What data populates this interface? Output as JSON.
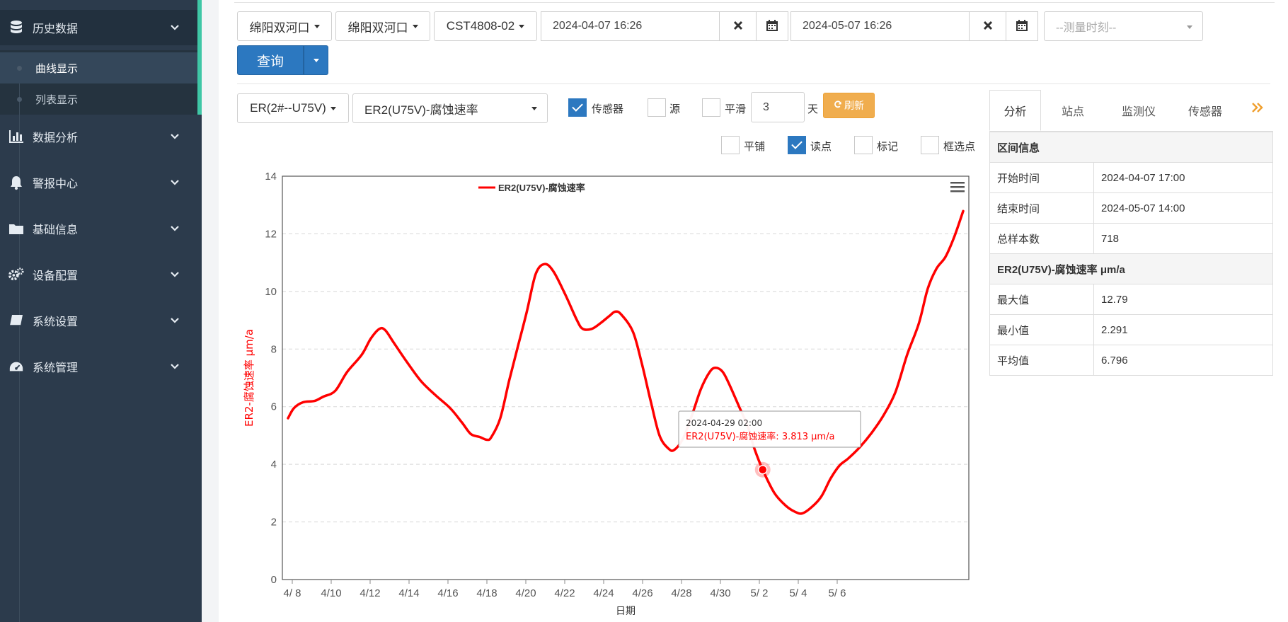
{
  "sidebar": {
    "items": [
      {
        "label": "历史数据",
        "icon": "database-icon"
      },
      {
        "label": "数据分析",
        "icon": "bar-chart-icon"
      },
      {
        "label": "警报中心",
        "icon": "bell-icon"
      },
      {
        "label": "基础信息",
        "icon": "folder-icon"
      },
      {
        "label": "设备配置",
        "icon": "gears-icon"
      },
      {
        "label": "系统设置",
        "icon": "book-icon"
      },
      {
        "label": "系统管理",
        "icon": "dashboard-icon"
      }
    ],
    "subitems": [
      {
        "label": "曲线显示",
        "active": true
      },
      {
        "label": "列表显示",
        "active": false
      }
    ]
  },
  "toolbar": {
    "region1": "绵阳双河口",
    "region2": "绵阳双河口",
    "device": "CST4808-02",
    "start_time": "2024-04-07 16:26",
    "end_time": "2024-05-07 16:26",
    "measure_placeholder": "--测量时刻--",
    "query_label": "查询"
  },
  "options": {
    "probe_select": "ER(2#--U75V)",
    "metric_select": "ER2(U75V)-腐蚀速率",
    "sensor_label": "传感器",
    "source_label": "源",
    "smooth_label": "平滑",
    "smooth_value": "3",
    "days_label": "天",
    "refresh_label": "刷新",
    "tile_label": "平铺",
    "readpoint_label": "读点",
    "mark_label": "标记",
    "boxselect_label": "框选点",
    "checks": {
      "sensor": true,
      "source": false,
      "smooth": false,
      "tile": false,
      "readpoint": true,
      "mark": false,
      "boxselect": false
    }
  },
  "chart_data": {
    "type": "line",
    "legend": "ER2(U75V)-腐蚀速率",
    "legend_position": "top-left",
    "series": [
      {
        "name": "ER2(U75V)-腐蚀速率",
        "color": "#ff0000",
        "points": [
          [
            0.0,
            5.6
          ],
          [
            0.2,
            5.95
          ],
          [
            0.5,
            6.15
          ],
          [
            0.9,
            6.2
          ],
          [
            1.2,
            6.35
          ],
          [
            1.6,
            6.55
          ],
          [
            2.0,
            7.2
          ],
          [
            2.5,
            7.8
          ],
          [
            2.8,
            8.35
          ],
          [
            3.1,
            8.7
          ],
          [
            3.3,
            8.65
          ],
          [
            3.6,
            8.2
          ],
          [
            4.0,
            7.6
          ],
          [
            4.5,
            6.9
          ],
          [
            5.0,
            6.4
          ],
          [
            5.5,
            5.95
          ],
          [
            5.9,
            5.45
          ],
          [
            6.2,
            5.05
          ],
          [
            6.5,
            4.95
          ],
          [
            6.75,
            4.85
          ],
          [
            6.9,
            4.95
          ],
          [
            7.2,
            5.6
          ],
          [
            7.5,
            6.9
          ],
          [
            7.8,
            8.1
          ],
          [
            8.1,
            9.3
          ],
          [
            8.4,
            10.6
          ],
          [
            8.7,
            10.95
          ],
          [
            9.0,
            10.7
          ],
          [
            9.4,
            9.9
          ],
          [
            9.8,
            9.0
          ],
          [
            10.0,
            8.7
          ],
          [
            10.3,
            8.7
          ],
          [
            10.6,
            8.9
          ],
          [
            10.9,
            9.15
          ],
          [
            11.1,
            9.3
          ],
          [
            11.3,
            9.2
          ],
          [
            11.7,
            8.6
          ],
          [
            12.0,
            7.5
          ],
          [
            12.3,
            6.2
          ],
          [
            12.6,
            5.0
          ],
          [
            12.9,
            4.55
          ],
          [
            13.1,
            4.5
          ],
          [
            13.4,
            4.9
          ],
          [
            13.7,
            5.7
          ],
          [
            14.0,
            6.6
          ],
          [
            14.3,
            7.2
          ],
          [
            14.5,
            7.35
          ],
          [
            14.75,
            7.2
          ],
          [
            15.0,
            6.7
          ],
          [
            15.3,
            6.0
          ],
          [
            15.6,
            5.3
          ],
          [
            15.8,
            4.6
          ],
          [
            16.1,
            3.813
          ],
          [
            16.5,
            3.0
          ],
          [
            16.9,
            2.55
          ],
          [
            17.2,
            2.35
          ],
          [
            17.45,
            2.3
          ],
          [
            17.8,
            2.55
          ],
          [
            18.1,
            2.9
          ],
          [
            18.4,
            3.5
          ],
          [
            18.7,
            3.95
          ],
          [
            19.0,
            4.2
          ],
          [
            19.4,
            4.6
          ],
          [
            19.8,
            5.1
          ],
          [
            20.2,
            5.7
          ],
          [
            20.6,
            6.5
          ],
          [
            21.0,
            7.8
          ],
          [
            21.4,
            8.9
          ],
          [
            21.7,
            10.1
          ],
          [
            22.0,
            10.8
          ],
          [
            22.3,
            11.2
          ],
          [
            22.6,
            11.9
          ],
          [
            22.9,
            12.79
          ]
        ]
      }
    ],
    "x_ticks": [
      "4/ 8",
      "4/10",
      "4/12",
      "4/14",
      "4/16",
      "4/18",
      "4/20",
      "4/22",
      "4/24",
      "4/26",
      "4/28",
      "4/30",
      "5/ 2",
      "5/ 4",
      "5/ 6"
    ],
    "x_range": [
      "2024-04-07 17:00",
      "2024-05-07 14:00"
    ],
    "xlabel": "日期",
    "ylabel": "ER2-腐蚀速率 μm/a",
    "ylim": [
      0,
      14
    ],
    "y_ticks": [
      0,
      2,
      4,
      6,
      8,
      10,
      12,
      14
    ],
    "grid": true,
    "tooltip": {
      "time": "2024-04-29 02:00",
      "text": "ER2(U75V)-腐蚀速率: 3.813 μm/a",
      "x": 16.1,
      "y": 3.813
    }
  },
  "panel": {
    "tabs": [
      "分析",
      "站点",
      "监测仪",
      "传感器"
    ],
    "active_tab": "分析",
    "section1_title": "区间信息",
    "rows1": [
      {
        "k": "开始时间",
        "v": "2024-04-07 17:00"
      },
      {
        "k": "结束时间",
        "v": "2024-05-07 14:00"
      },
      {
        "k": "总样本数",
        "v": "718"
      }
    ],
    "section2_title": "ER2(U75V)-腐蚀速率 μm/a",
    "rows2": [
      {
        "k": "最大值",
        "v": "12.79"
      },
      {
        "k": "最小值",
        "v": "2.291"
      },
      {
        "k": "平均值",
        "v": "6.796"
      }
    ]
  }
}
